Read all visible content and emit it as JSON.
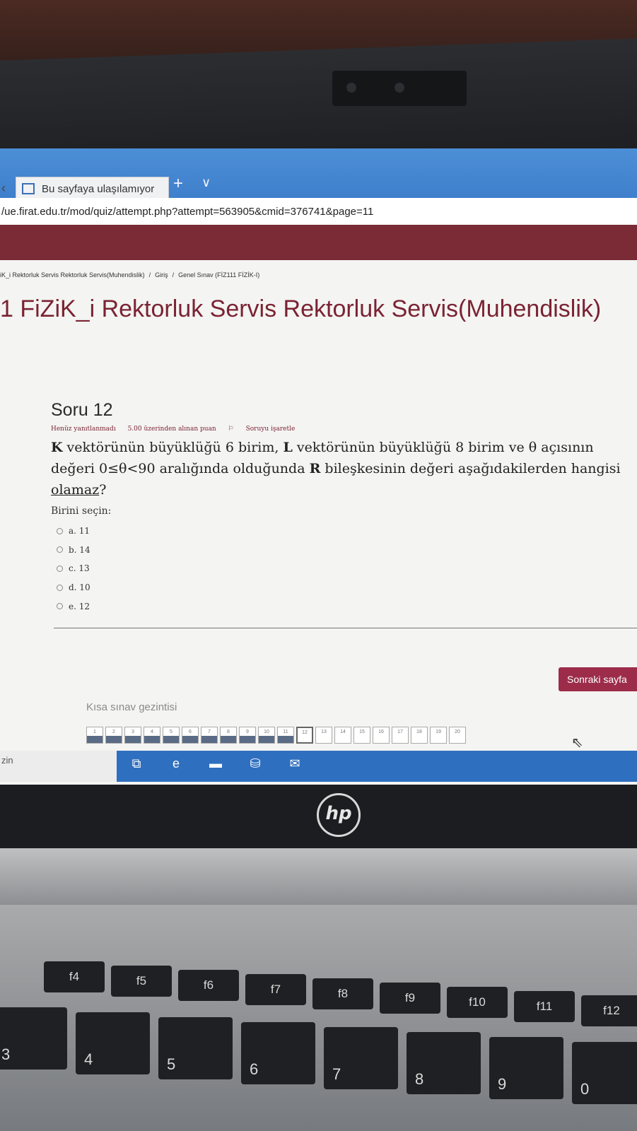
{
  "browser": {
    "tab_title": "Bu sayfaya ulaşılamıyor",
    "new_tab_glyph": "+",
    "tab_menu_glyph": "∨",
    "back_glyph": "‹",
    "address": "/ue.firat.edu.tr/mod/quiz/attempt.php?attempt=563905&cmid=376741&page=11"
  },
  "breadcrumb": [
    "iK_i Rektorluk Servis Rektorluk Servis(Muhendislik)",
    "Giriş",
    "Genel Sınav (FİZ111 FİZİK-I)"
  ],
  "breadcrumb_sep": "/",
  "course_title": "1 FiZiK_i Rektorluk Servis Rektorluk Servis(Muhendislik)",
  "question": {
    "heading": "Soru 12",
    "status": "Henüz yanıtlanmadı",
    "grade": "5.00 üzerinden alınan puan",
    "flag_icon": "⚐",
    "flag": "Soruyu işaretle",
    "text_parts": [
      {
        "b": "K",
        "t": " vektörünün büyüklüğü 6 birim, "
      },
      {
        "b": "L",
        "t": " vektörünün büyüklüğü 8 birim ve θ açısının değeri 0≤θ<90 aralığında olduğunda "
      },
      {
        "b": "R",
        "t": " bileşkesinin değeri aşağıdakilerden hangisi "
      }
    ],
    "underlined": "olamaz",
    "end": "?",
    "prompt": "Birini seçin:",
    "options": [
      "a. 11",
      "b. 14",
      "c. 13",
      "d. 10",
      "e. 12"
    ]
  },
  "next_button": "Sonraki sayfa",
  "quiz_nav": {
    "title": "Kısa sınav gezintisi",
    "numbers": [
      "1",
      "2",
      "3",
      "4",
      "5",
      "6",
      "7",
      "8",
      "9",
      "10",
      "11",
      "12",
      "13",
      "14",
      "15",
      "16",
      "17",
      "18",
      "19",
      "20"
    ],
    "answered_count": 11,
    "current": "12"
  },
  "taskbar": {
    "search_fragment": "zin",
    "icons": [
      "task-view-icon",
      "edge-icon",
      "file-explorer-icon",
      "store-icon",
      "mail-icon"
    ],
    "glyphs": [
      "⧉",
      "e",
      "▬",
      "⛁",
      "✉"
    ]
  },
  "laptop": {
    "logo": "hp",
    "fkeys": [
      "f4",
      "f5",
      "f6",
      "f7",
      "f8",
      "f9",
      "f10",
      "f11",
      "f12"
    ],
    "number_keys": [
      "3",
      "4",
      "5",
      "6",
      "7",
      "8",
      "9",
      "0"
    ]
  }
}
